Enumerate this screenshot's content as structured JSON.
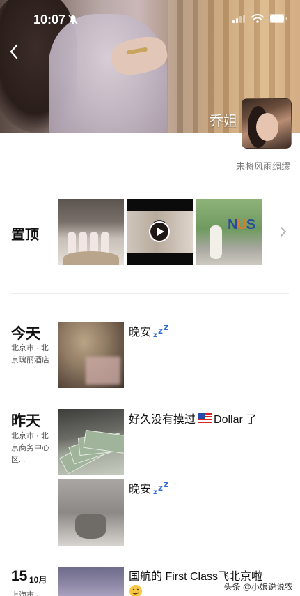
{
  "status_bar": {
    "time": "10:07"
  },
  "profile": {
    "name": "乔姐",
    "signature": "未将风雨绸缪"
  },
  "pinned": {
    "label": "置顶"
  },
  "timeline": [
    {
      "day": "今天",
      "location": "北京市 · 北京瑰丽酒店",
      "text": "晚安"
    },
    {
      "day": "昨天",
      "location": "北京市 · 北京商务中心区...",
      "posts": [
        {
          "text_before": "好久没有摸过",
          "text_after": "Dollar 了"
        },
        {
          "text": "晚安"
        }
      ]
    },
    {
      "date_day": "15",
      "date_month": "10月",
      "location": "上海市 ·",
      "text": "国航的 First Class飞北京啦"
    }
  ],
  "watermark": "头条 @小娘说说农"
}
